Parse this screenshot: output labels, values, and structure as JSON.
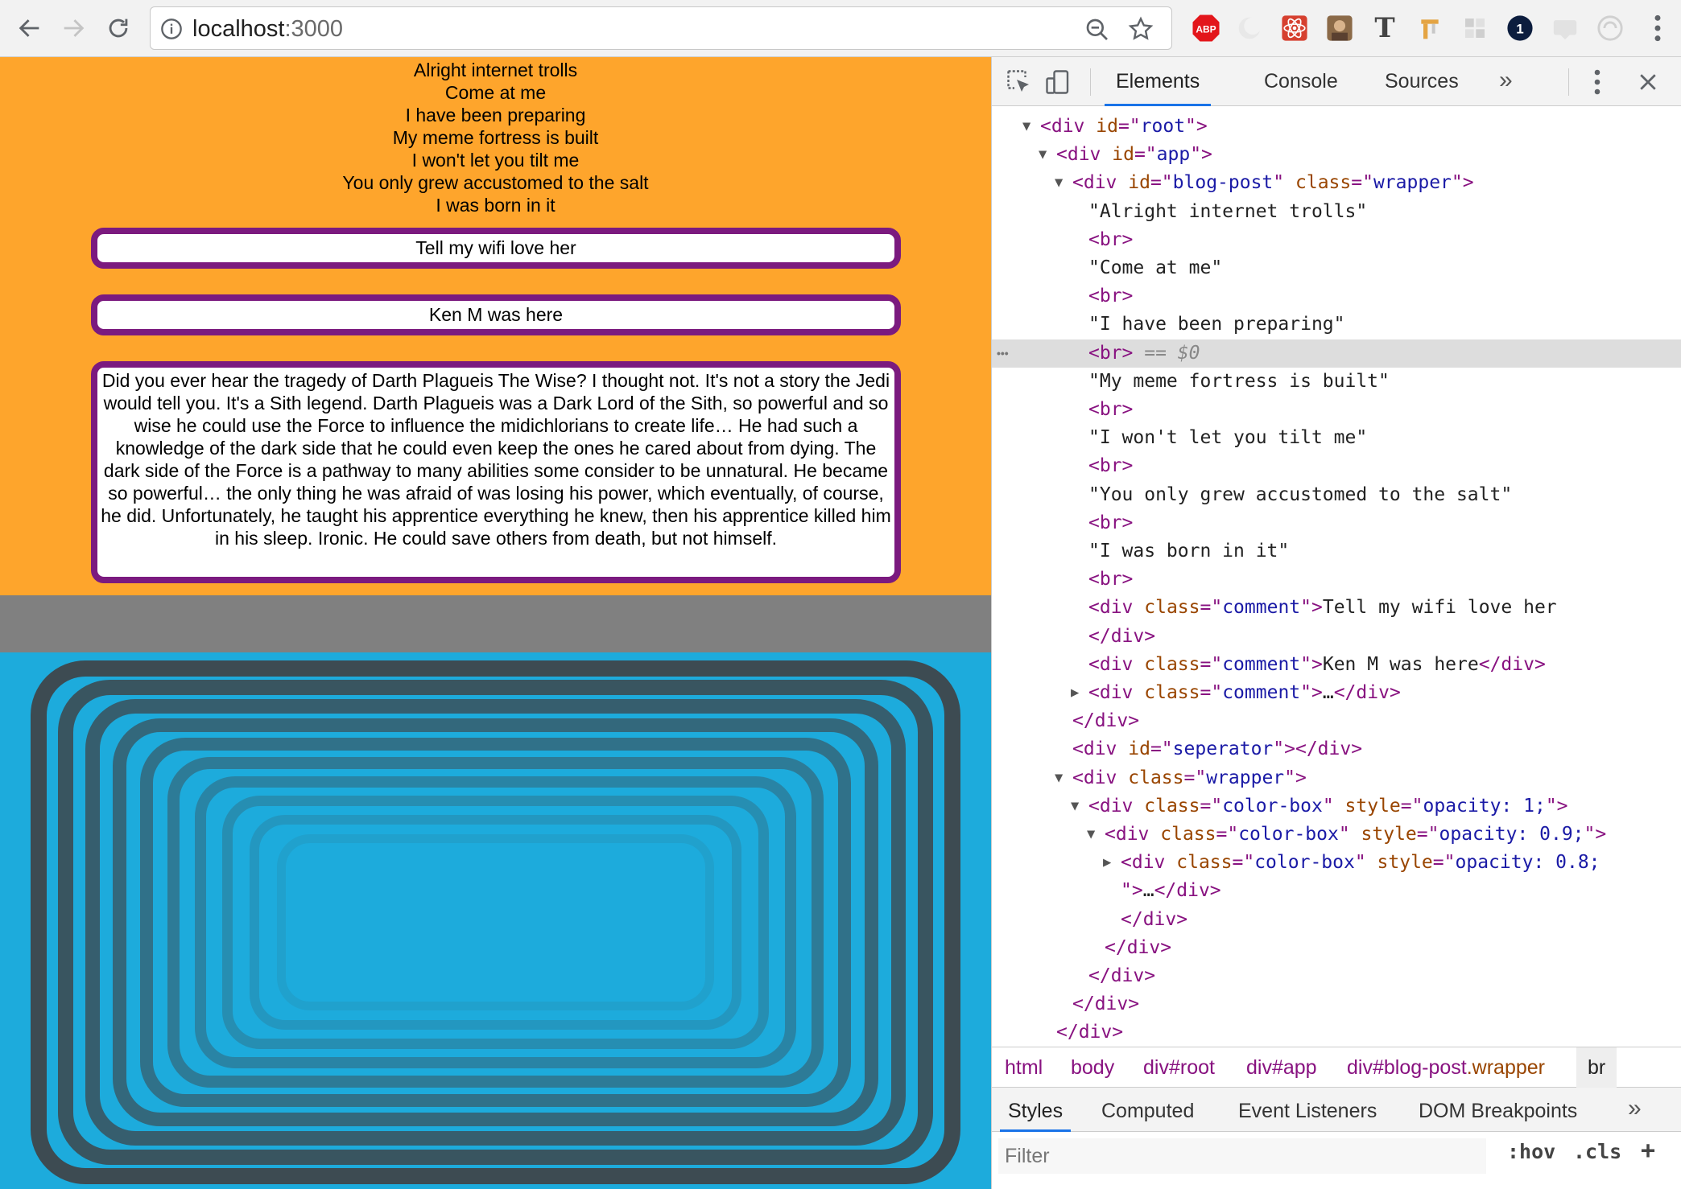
{
  "browser": {
    "url_host": "localhost",
    "url_port": ":3000",
    "extensions": [
      "adblock-icon",
      "moon-icon",
      "react-icon",
      "avatar-ext-icon",
      "type-t-icon",
      "tool-icon",
      "grid-icon",
      "onepassword-icon",
      "css-icon",
      "scroll-icon"
    ],
    "abp_label": "ABP",
    "t_label": "T",
    "one_label": "1"
  },
  "blog": {
    "lines": [
      "Alright internet trolls",
      "Come at me",
      "I have been preparing",
      "My meme fortress is built",
      "I won't let you tilt me",
      "You only grew accustomed to the salt",
      "I was born in it"
    ],
    "comments": [
      "Tell my wifi love her",
      "Ken M was here",
      "Did you ever hear the tragedy of Darth Plagueis The Wise? I thought not. It's not a story the Jedi would tell you. It's a Sith legend. Darth Plagueis was a Dark Lord of the Sith, so powerful and so wise he could use the Force to influence the midichlorians to create life… He had such a knowledge of the dark side that he could even keep the ones he cared about from dying. The dark side of the Force is a pathway to many abilities some consider to be unnatural. He became so powerful… the only thing he was afraid of was losing his power, which eventually, of course, he did. Unfortunately, he taught his apprentice everything he knew, then his apprentice killed him in his sleep. Ironic. He could save others from death, but not himself."
    ]
  },
  "color_boxes": {
    "opacities": [
      1,
      0.9,
      0.8,
      0.7,
      0.6,
      0.5,
      0.4,
      0.3,
      0.2,
      0.1
    ],
    "border_color": "#3d4b52",
    "background_color": "#1dabdc"
  },
  "colors": {
    "blog_bg": "#fea52c",
    "comment_border": "#7b1a7f",
    "seperator": "#808080"
  },
  "devtools": {
    "tabs": [
      "Elements",
      "Console",
      "Sources"
    ],
    "more": "»",
    "rows": [
      {
        "d": 0,
        "t": "▼",
        "h": "<span class=\"tag\">&lt;div</span> <span class=\"attr\">id</span><span class=\"tag\">=\"</span><span class=\"val\">root</span><span class=\"tag\">\"&gt;</span>"
      },
      {
        "d": 1,
        "t": "▼",
        "h": "<span class=\"tag\">&lt;div</span> <span class=\"attr\">id</span><span class=\"tag\">=\"</span><span class=\"val\">app</span><span class=\"tag\">\"&gt;</span>"
      },
      {
        "d": 2,
        "t": "▼",
        "h": "<span class=\"tag\">&lt;div</span> <span class=\"attr\">id</span><span class=\"tag\">=\"</span><span class=\"val\">blog-post</span><span class=\"tag\">\"</span> <span class=\"attr\">class</span><span class=\"tag\">=\"</span><span class=\"val\">wrapper</span><span class=\"tag\">\"&gt;</span>"
      },
      {
        "d": 3,
        "t": "",
        "h": "<span class=\"txt\">\"Alright internet trolls\"</span>"
      },
      {
        "d": 3,
        "t": "",
        "h": "<span class=\"tag\">&lt;br&gt;</span>"
      },
      {
        "d": 3,
        "t": "",
        "h": "<span class=\"txt\">\"Come at me\"</span>"
      },
      {
        "d": 3,
        "t": "",
        "h": "<span class=\"tag\">&lt;br&gt;</span>"
      },
      {
        "d": 3,
        "t": "",
        "h": "<span class=\"txt\">\"I have been preparing\"</span>"
      },
      {
        "d": 3,
        "t": "",
        "h": "<span class=\"tag\">&lt;br&gt;</span> <span class=\"eq\">== $0</span>",
        "sel": true
      },
      {
        "d": 3,
        "t": "",
        "h": "<span class=\"txt\">\"My meme fortress is built\"</span>"
      },
      {
        "d": 3,
        "t": "",
        "h": "<span class=\"tag\">&lt;br&gt;</span>"
      },
      {
        "d": 3,
        "t": "",
        "h": "<span class=\"txt\">\"I won't let you tilt me\"</span>"
      },
      {
        "d": 3,
        "t": "",
        "h": "<span class=\"tag\">&lt;br&gt;</span>"
      },
      {
        "d": 3,
        "t": "",
        "h": "<span class=\"txt\">\"You only grew accustomed to the salt\"</span>"
      },
      {
        "d": 3,
        "t": "",
        "h": "<span class=\"tag\">&lt;br&gt;</span>"
      },
      {
        "d": 3,
        "t": "",
        "h": "<span class=\"txt\">\"I was born in it\"</span>"
      },
      {
        "d": 3,
        "t": "",
        "h": "<span class=\"tag\">&lt;br&gt;</span>"
      },
      {
        "d": 3,
        "t": "",
        "h": "<span class=\"tag\">&lt;div</span> <span class=\"attr\">class</span><span class=\"tag\">=\"</span><span class=\"val\">comment</span><span class=\"tag\">\"&gt;</span><span class=\"txt\">Tell my wifi love her</span>"
      },
      {
        "d": 3,
        "t": "",
        "h": "<span class=\"tag\">&lt;/div&gt;</span>"
      },
      {
        "d": 3,
        "t": "",
        "h": "<span class=\"tag\">&lt;div</span> <span class=\"attr\">class</span><span class=\"tag\">=\"</span><span class=\"val\">comment</span><span class=\"tag\">\"&gt;</span><span class=\"txt\">Ken M was here</span><span class=\"tag\">&lt;/div&gt;</span>"
      },
      {
        "d": 3,
        "t": "▶",
        "h": "<span class=\"tag\">&lt;div</span> <span class=\"attr\">class</span><span class=\"tag\">=\"</span><span class=\"val\">comment</span><span class=\"tag\">\"&gt;</span><span class=\"txt\">…</span><span class=\"tag\">&lt;/div&gt;</span>"
      },
      {
        "d": 2,
        "t": "",
        "h": "<span class=\"tag\">&lt;/div&gt;</span>"
      },
      {
        "d": 2,
        "t": "",
        "h": "<span class=\"tag\">&lt;div</span> <span class=\"attr\">id</span><span class=\"tag\">=\"</span><span class=\"val\">seperator</span><span class=\"tag\">\"&gt;&lt;/div&gt;</span>"
      },
      {
        "d": 2,
        "t": "▼",
        "h": "<span class=\"tag\">&lt;div</span> <span class=\"attr\">class</span><span class=\"tag\">=\"</span><span class=\"val\">wrapper</span><span class=\"tag\">\"&gt;</span>"
      },
      {
        "d": 3,
        "t": "▼",
        "h": "<span class=\"tag\">&lt;div</span> <span class=\"attr\">class</span><span class=\"tag\">=\"</span><span class=\"val\">color-box</span><span class=\"tag\">\"</span> <span class=\"attr\">style</span><span class=\"tag\">=\"</span><span class=\"val\">opacity: 1;</span><span class=\"tag\">\"&gt;</span>"
      },
      {
        "d": 4,
        "t": "▼",
        "h": "<span class=\"tag\">&lt;div</span> <span class=\"attr\">class</span><span class=\"tag\">=\"</span><span class=\"val\">color-box</span><span class=\"tag\">\"</span> <span class=\"attr\">style</span><span class=\"tag\">=\"</span><span class=\"val\">opacity: 0.9;</span><span class=\"tag\">\"&gt;</span>"
      },
      {
        "d": 5,
        "t": "▶",
        "h": "<span class=\"tag\">&lt;div</span> <span class=\"attr\">class</span><span class=\"tag\">=\"</span><span class=\"val\">color-box</span><span class=\"tag\">\"</span> <span class=\"attr\">style</span><span class=\"tag\">=\"</span><span class=\"val\">opacity: 0.8;</span>"
      },
      {
        "d": 5,
        "t": "",
        "h": "<span class=\"tag\">\"&gt;</span><span class=\"txt\">…</span><span class=\"tag\">&lt;/div&gt;</span>"
      },
      {
        "d": 5,
        "t": "",
        "h": "<span class=\"tag\">&lt;/div&gt;</span>"
      },
      {
        "d": 4,
        "t": "",
        "h": "<span class=\"tag\">&lt;/div&gt;</span>"
      },
      {
        "d": 3,
        "t": "",
        "h": "<span class=\"tag\">&lt;/div&gt;</span>"
      },
      {
        "d": 2,
        "t": "",
        "h": "<span class=\"tag\">&lt;/div&gt;</span>"
      },
      {
        "d": 1,
        "t": "",
        "h": "<span class=\"tag\">&lt;/div&gt;</span>"
      }
    ],
    "breadcrumbs": {
      "html": "html",
      "body": "body",
      "root_tag": "div",
      "root_id": "#root",
      "app_tag": "div",
      "app_id": "#app",
      "blog_tag": "div",
      "blog_id": "#blog-post",
      "blog_class": ".wrapper",
      "selected": "br"
    },
    "style_tabs": [
      "Styles",
      "Computed",
      "Event Listeners",
      "DOM Breakpoints"
    ],
    "filter_placeholder": "Filter",
    "hov": ":hov",
    "cls": ".cls",
    "plus": "+"
  }
}
